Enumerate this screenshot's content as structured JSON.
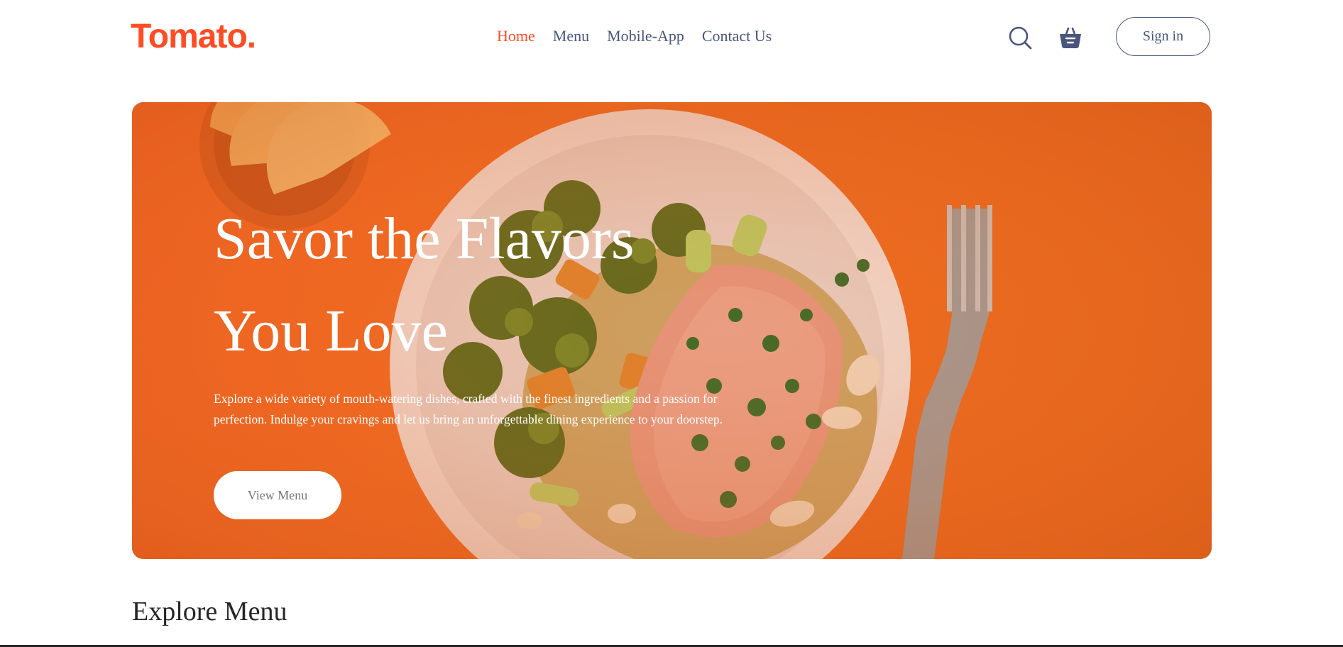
{
  "brand": {
    "logo_text": "Tomato.",
    "accent_color": "#ff4c24",
    "text_color": "#49557e"
  },
  "nav": {
    "links": [
      {
        "label": "Home",
        "active": true
      },
      {
        "label": "Menu",
        "active": false
      },
      {
        "label": "Mobile-App",
        "active": false
      },
      {
        "label": "Contact Us",
        "active": false
      }
    ],
    "icons": [
      "search-icon",
      "basket-icon"
    ],
    "signin_label": "Sign in"
  },
  "hero": {
    "title_line1": "Savor the Flavors",
    "title_line2": "You Love",
    "description": "Explore a wide variety of mouth-watering dishes, crafted with the finest ingredients and a passion for perfection. Indulge your cravings and let us bring an unforgettable dining experience to your doorstep.",
    "button_label": "View Menu",
    "background_color": "#f06c22"
  },
  "explore": {
    "title": "Explore Menu"
  }
}
